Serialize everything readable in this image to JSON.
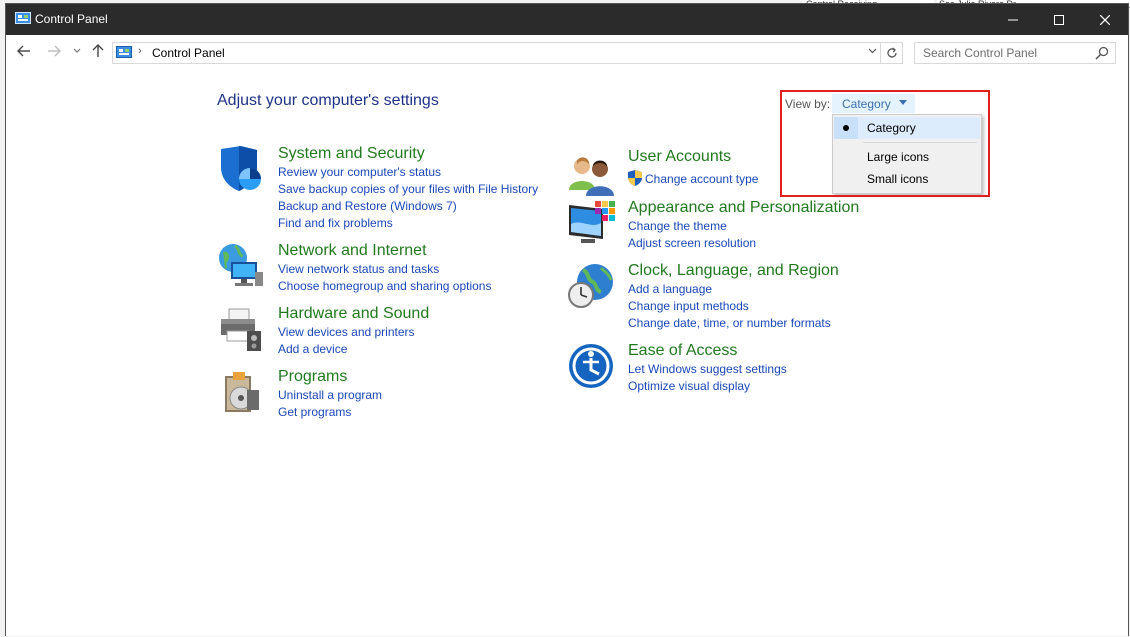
{
  "window": {
    "title": "Control Panel",
    "controls": {
      "minimize": "—",
      "maximize": "☐",
      "close": "✕"
    }
  },
  "background_window": {
    "snippet_1": "Control Receiving",
    "snippet_2": "Sec Julie Rivera Dr."
  },
  "navigation": {
    "address": "Control Panel",
    "search_placeholder": "Search Control Panel"
  },
  "page": {
    "title": "Adjust your computer's settings",
    "view_by_label": "View by:",
    "view_by_value": "Category",
    "view_options": [
      "Category",
      "Large icons",
      "Small icons"
    ],
    "selected_view": "Category"
  },
  "categories": {
    "system_security": {
      "title": "System and Security",
      "links": [
        "Review your computer's status",
        "Save backup copies of your files with File History",
        "Backup and Restore (Windows 7)",
        "Find and fix problems"
      ]
    },
    "network_internet": {
      "title": "Network and Internet",
      "links": [
        "View network status and tasks",
        "Choose homegroup and sharing options"
      ]
    },
    "hardware_sound": {
      "title": "Hardware and Sound",
      "links": [
        "View devices and printers",
        "Add a device"
      ]
    },
    "programs": {
      "title": "Programs",
      "links": [
        "Uninstall a program",
        "Get programs"
      ]
    },
    "user_accounts": {
      "title": "User Accounts",
      "links": [
        "Change account type"
      ]
    },
    "appearance": {
      "title": "Appearance and Personalization",
      "links": [
        "Change the theme",
        "Adjust screen resolution"
      ]
    },
    "clock_region": {
      "title": "Clock, Language, and Region",
      "links": [
        "Add a language",
        "Change input methods",
        "Change date, time, or number formats"
      ]
    },
    "ease_access": {
      "title": "Ease of Access",
      "links": [
        "Let Windows suggest settings",
        "Optimize visual display"
      ]
    }
  },
  "colors": {
    "title_bar": "#2b2b2b",
    "category_title": "#217a1e",
    "link": "#1a48b8",
    "page_title": "#1e3287",
    "highlight_box": "#e0201f"
  }
}
